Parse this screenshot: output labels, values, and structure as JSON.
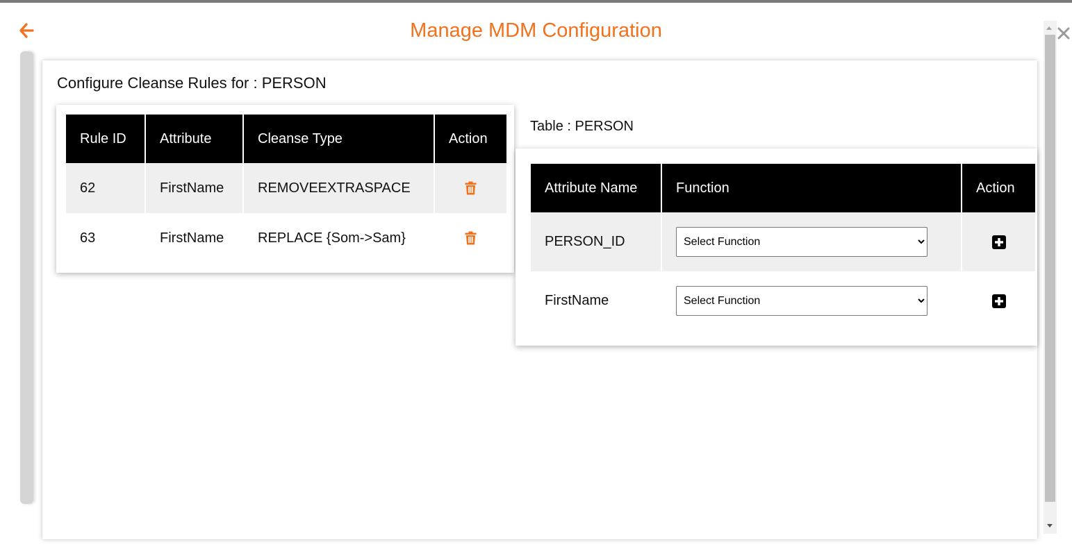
{
  "header": {
    "title": "Manage MDM Configuration"
  },
  "panel": {
    "heading": "Configure Cleanse Rules for : PERSON"
  },
  "rules_table": {
    "columns": [
      "Rule ID",
      "Attribute",
      "Cleanse Type",
      "Action"
    ],
    "rows": [
      {
        "rule_id": "62",
        "attribute": "FirstName",
        "cleanse_type": "REMOVEEXTRASPACE"
      },
      {
        "rule_id": "63",
        "attribute": "FirstName",
        "cleanse_type": "REPLACE {Som->Sam}"
      }
    ]
  },
  "attributes_section": {
    "table_label": "Table : PERSON",
    "columns": [
      "Attribute Name",
      "Function",
      "Action"
    ],
    "rows": [
      {
        "attribute_name": "PERSON_ID",
        "function": "Select Function"
      },
      {
        "attribute_name": "FirstName",
        "function": "Select Function"
      }
    ]
  },
  "colors": {
    "accent": "#f2711c",
    "header_bg": "#000000",
    "row_shade": "#efefef"
  },
  "icons": {
    "back": "arrow-left-icon",
    "close": "close-icon",
    "delete": "trash-icon",
    "add": "plus-square-icon"
  }
}
